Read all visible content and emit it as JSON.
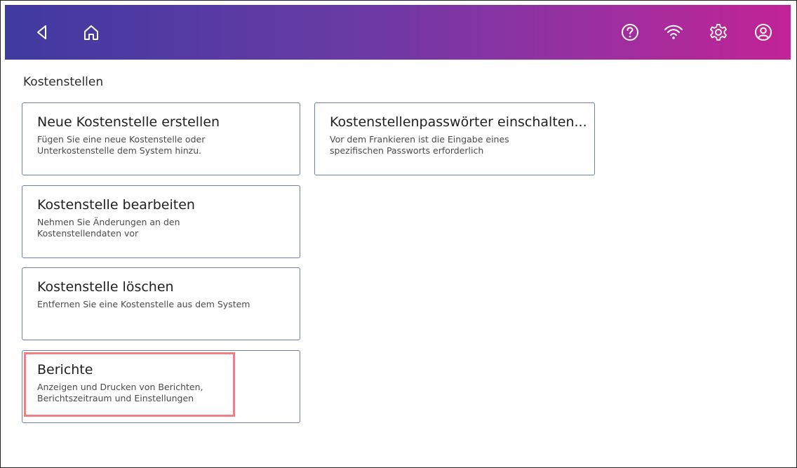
{
  "header": {
    "icons": {
      "back": "back-arrow-icon",
      "home": "home-icon",
      "help": "help-icon",
      "wifi": "wifi-icon",
      "settings": "gear-icon",
      "account": "account-icon"
    },
    "gradient_colors": [
      "#3f3aa0",
      "#c22396"
    ]
  },
  "page": {
    "title": "Kostenstellen"
  },
  "tiles": [
    {
      "title": "Neue Kostenstelle erstellen",
      "description": "Fügen Sie eine neue Kostenstelle oder Unterkostenstelle dem System hinzu."
    },
    {
      "title": "Kostenstellenpasswörter einschalten...",
      "description": "Vor dem Frankieren ist die Eingabe eines spezifischen Passworts erforderlich"
    },
    {
      "title": "Kostenstelle bearbeiten",
      "description": "Nehmen Sie Änderungen an den Kostenstellendaten vor"
    },
    {
      "title": "Kostenstelle löschen",
      "description": "Entfernen Sie eine Kostenstelle aus dem System"
    },
    {
      "title": "Berichte",
      "description": "Anzeigen und Drucken von Berichten, Berichtszeitraum und Einstellungen"
    }
  ],
  "colors": {
    "tile_border": "#6f7fb6",
    "highlight": "#ef7f86"
  }
}
